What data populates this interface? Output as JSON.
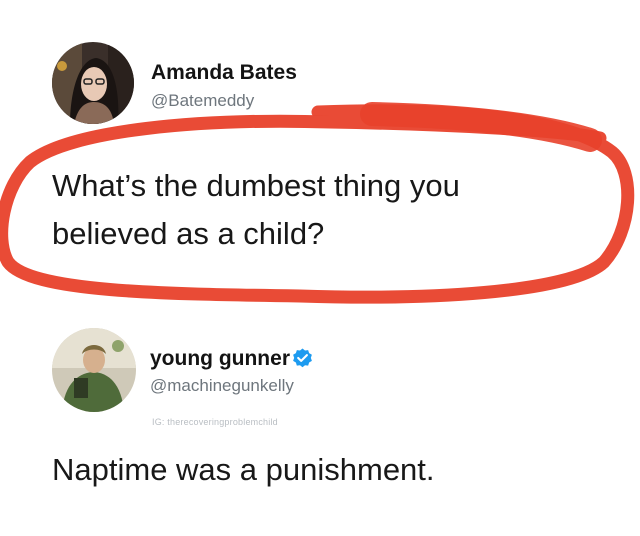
{
  "tweets": [
    {
      "display_name": "Amanda Bates",
      "handle": "@Batemeddy",
      "text_line1": "What’s the dumbest thing you",
      "text_line2": "believed as a child?",
      "avatar_icon": "user-avatar-photo"
    },
    {
      "display_name": "young gunner",
      "handle": "@machinegunkelly",
      "verified_icon": "verified-badge-icon",
      "watermark": "IG: therecoveringproblemchild",
      "text": "Naptime was a punishment.",
      "avatar_icon": "user-avatar-photo"
    }
  ],
  "colors": {
    "annotation_red": "#e8412b",
    "verified_blue": "#1d9bf0",
    "handle_gray": "#6e767d"
  }
}
